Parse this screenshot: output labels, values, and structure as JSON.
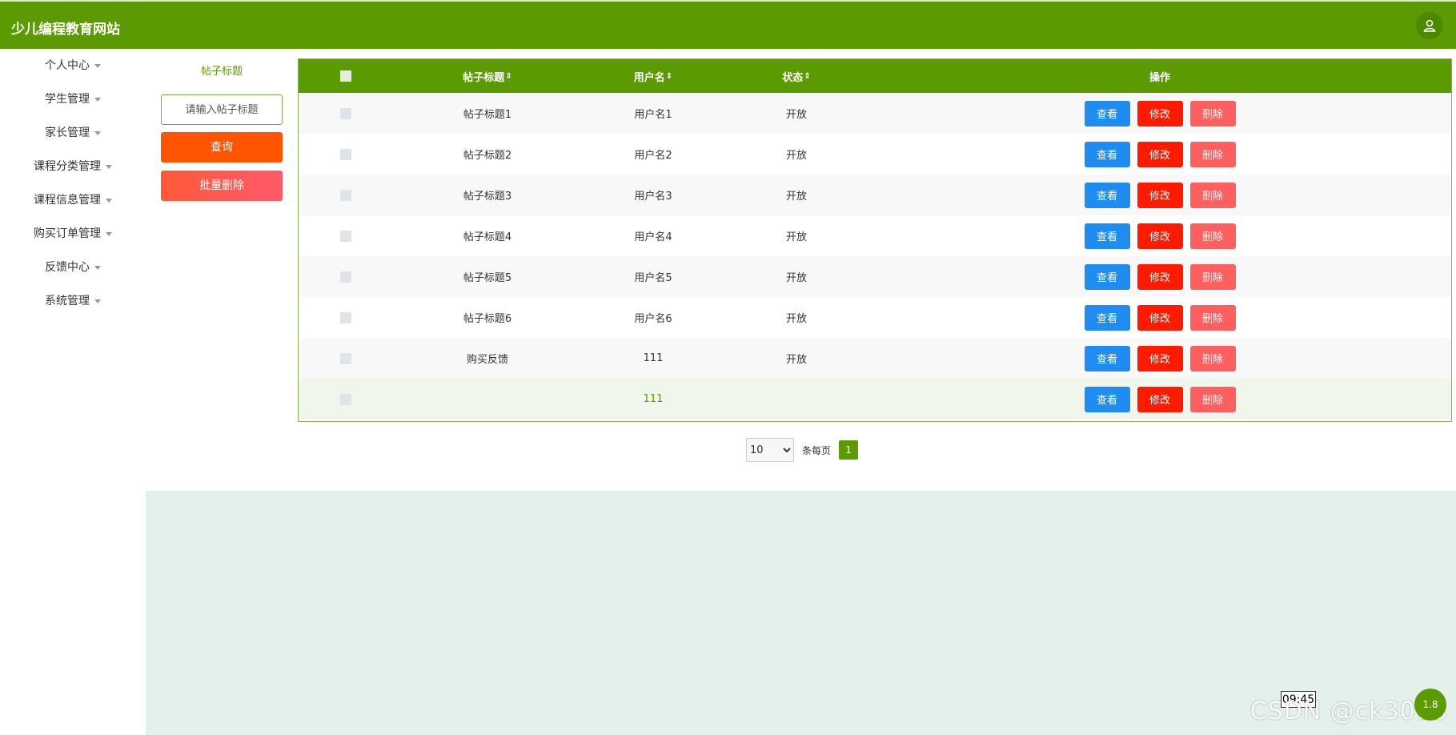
{
  "header": {
    "site_title": "少儿编程教育网站",
    "user_icon": "user-icon"
  },
  "sidebar": {
    "items": [
      {
        "label": "个人中心"
      },
      {
        "label": "学生管理"
      },
      {
        "label": "家长管理"
      },
      {
        "label": "课程分类管理"
      },
      {
        "label": "课程信息管理"
      },
      {
        "label": "购买订单管理"
      },
      {
        "label": "反馈中心"
      },
      {
        "label": "系统管理"
      }
    ]
  },
  "filter": {
    "label": "帖子标题",
    "placeholder": "请输入帖子标题",
    "query_button": "查询",
    "batch_delete_button": "批量删除"
  },
  "table": {
    "columns": {
      "title": "帖子标题",
      "username": "用户名",
      "status": "状态",
      "actions": "操作"
    },
    "sort_glyph": "⇕",
    "rows": [
      {
        "title": "帖子标题1",
        "username": "用户名1",
        "status": "开放"
      },
      {
        "title": "帖子标题2",
        "username": "用户名2",
        "status": "开放"
      },
      {
        "title": "帖子标题3",
        "username": "用户名3",
        "status": "开放"
      },
      {
        "title": "帖子标题4",
        "username": "用户名4",
        "status": "开放"
      },
      {
        "title": "帖子标题5",
        "username": "用户名5",
        "status": "开放"
      },
      {
        "title": "帖子标题6",
        "username": "用户名6",
        "status": "开放"
      },
      {
        "title": "购买反馈",
        "username": "111",
        "status": "开放"
      },
      {
        "title": "",
        "username": "111",
        "status": ""
      }
    ],
    "actions": {
      "view": "查看",
      "edit": "修改",
      "delete": "删除"
    }
  },
  "pagination": {
    "page_size": "10",
    "page_size_options": [
      "10"
    ],
    "per_page_label": "条每页",
    "current_page": "1"
  },
  "overlay": {
    "time": "09:45",
    "watermark": "CSDN @ck3018",
    "fab_label": "1.8"
  },
  "colors": {
    "primary": "#5b9a00",
    "view": "#1e8cf0",
    "edit": "#ff1a00",
    "delete": "#ff5f5f",
    "query": "#ff5500"
  }
}
